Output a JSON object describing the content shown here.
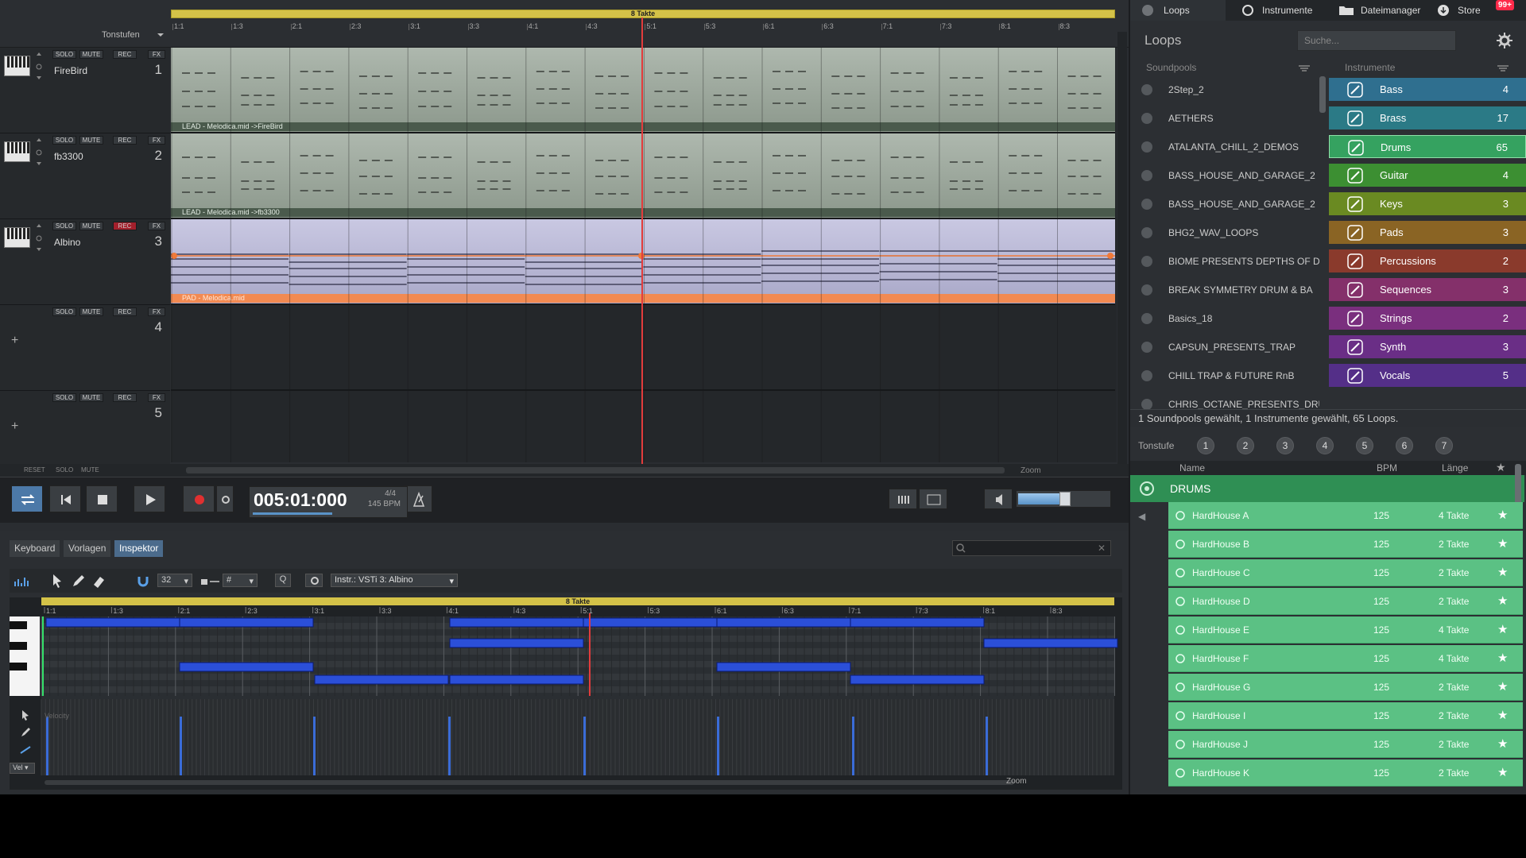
{
  "arrangement": {
    "tonstufen_label": "Tonstufen",
    "loop_range_label": "8 Takte",
    "ruler": [
      "1:1",
      "1:3",
      "2:1",
      "2:3",
      "3:1",
      "3:3",
      "4:1",
      "4:3",
      "5:1",
      "5:3",
      "6:1",
      "6:3",
      "7:1",
      "7:3",
      "8:1",
      "8:3"
    ],
    "tracks": [
      {
        "name": "FireBird",
        "number": "1",
        "clip": "LEAD - Melodica.mid ->FireBird",
        "solo": "SOLO",
        "mute": "MUTE",
        "rec": "REC",
        "fx": "FX"
      },
      {
        "name": "fb3300",
        "number": "2",
        "clip": "LEAD - Melodica.mid ->fb3300",
        "solo": "SOLO",
        "mute": "MUTE",
        "rec": "REC",
        "fx": "FX"
      },
      {
        "name": "Albino",
        "number": "3",
        "clip": "PAD - Melodica.mid",
        "solo": "SOLO",
        "mute": "MUTE",
        "rec": "REC",
        "fx": "FX"
      },
      {
        "name": "",
        "number": "4",
        "clip": "",
        "solo": "SOLO",
        "mute": "MUTE",
        "rec": "REC",
        "fx": "FX"
      },
      {
        "name": "",
        "number": "5",
        "clip": "",
        "solo": "SOLO",
        "mute": "MUTE",
        "rec": "REC",
        "fx": "FX"
      }
    ],
    "footer": {
      "reset": "RESET",
      "solo": "SOLO",
      "mute": "MUTE",
      "zoom": "Zoom"
    }
  },
  "transport": {
    "time": "005:01:000",
    "signature": "4/4",
    "bpm": "145 BPM"
  },
  "lower": {
    "tabs": [
      "Keyboard",
      "Vorlagen",
      "Inspektor"
    ],
    "active_tab": "Inspektor",
    "quant": "32",
    "length": "#",
    "q_label": "Q",
    "instrument": "Instr.: VSTi 3: Albino",
    "loop_range_label": "8 Takte",
    "ruler": [
      "1:1",
      "1:3",
      "2:1",
      "2:3",
      "3:1",
      "3:3",
      "4:1",
      "4:3",
      "5:1",
      "5:3",
      "6:1",
      "6:3",
      "7:1",
      "7:3",
      "8:1",
      "8:3"
    ],
    "velocity_label": "Velocity",
    "vel_dropdown": "Vel",
    "zoom": "Zoom"
  },
  "right": {
    "tabs": [
      "Loops",
      "Instrumente",
      "Dateimanager",
      "Store"
    ],
    "store_badge": "99+",
    "title": "Loops",
    "search_placeholder": "Suche...",
    "soundpools_header": "Soundpools",
    "instruments_header": "Instrumente",
    "soundpools": [
      "2Step_2",
      "AETHERS",
      "ATALANTA_CHILL_2_DEMOS",
      "BASS_HOUSE_AND_GARAGE_2",
      "BASS_HOUSE_AND_GARAGE_2",
      "BHG2_WAV_LOOPS",
      "BIOME PRESENTS DEPTHS OF D",
      "BREAK SYMMETRY DRUM & BA",
      "Basics_18",
      "CAPSUN_PRESENTS_TRAP",
      "CHILL TRAP & FUTURE RnB",
      "CHRIS_OCTANE_PRESENTS_DRU"
    ],
    "instruments": [
      {
        "name": "Bass",
        "count": "4",
        "color": "#2f6f8f"
      },
      {
        "name": "Brass",
        "count": "17",
        "color": "#2b7a86"
      },
      {
        "name": "Drums",
        "count": "65",
        "color": "#35a260"
      },
      {
        "name": "Guitar",
        "count": "4",
        "color": "#3c8f32"
      },
      {
        "name": "Keys",
        "count": "3",
        "color": "#6a8a22"
      },
      {
        "name": "Pads",
        "count": "3",
        "color": "#8a6424"
      },
      {
        "name": "Percussions",
        "count": "2",
        "color": "#8a3a2c"
      },
      {
        "name": "Sequences",
        "count": "3",
        "color": "#84306a"
      },
      {
        "name": "Strings",
        "count": "2",
        "color": "#7a2f7e"
      },
      {
        "name": "Synth",
        "count": "3",
        "color": "#6a2e86"
      },
      {
        "name": "Vocals",
        "count": "5",
        "color": "#542f88"
      }
    ],
    "status": "1 Soundpools gewählt, 1 Instrumente gewählt, 65 Loops.",
    "tonstufe_label": "Tonstufe",
    "tonstufen": [
      "1",
      "2",
      "3",
      "4",
      "5",
      "6",
      "7"
    ],
    "columns": {
      "name": "Name",
      "bpm": "BPM",
      "length": "Länge"
    },
    "category": "DRUMS",
    "loops": [
      {
        "name": "HardHouse A",
        "bpm": "125",
        "length": "4 Takte"
      },
      {
        "name": "HardHouse B",
        "bpm": "125",
        "length": "2 Takte"
      },
      {
        "name": "HardHouse C",
        "bpm": "125",
        "length": "2 Takte"
      },
      {
        "name": "HardHouse D",
        "bpm": "125",
        "length": "2 Takte"
      },
      {
        "name": "HardHouse E",
        "bpm": "125",
        "length": "4 Takte"
      },
      {
        "name": "HardHouse F",
        "bpm": "125",
        "length": "4 Takte"
      },
      {
        "name": "HardHouse G",
        "bpm": "125",
        "length": "2 Takte"
      },
      {
        "name": "HardHouse I",
        "bpm": "125",
        "length": "2 Takte"
      },
      {
        "name": "HardHouse J",
        "bpm": "125",
        "length": "2 Takte"
      },
      {
        "name": "HardHouse K",
        "bpm": "125",
        "length": "2 Takte"
      }
    ]
  }
}
